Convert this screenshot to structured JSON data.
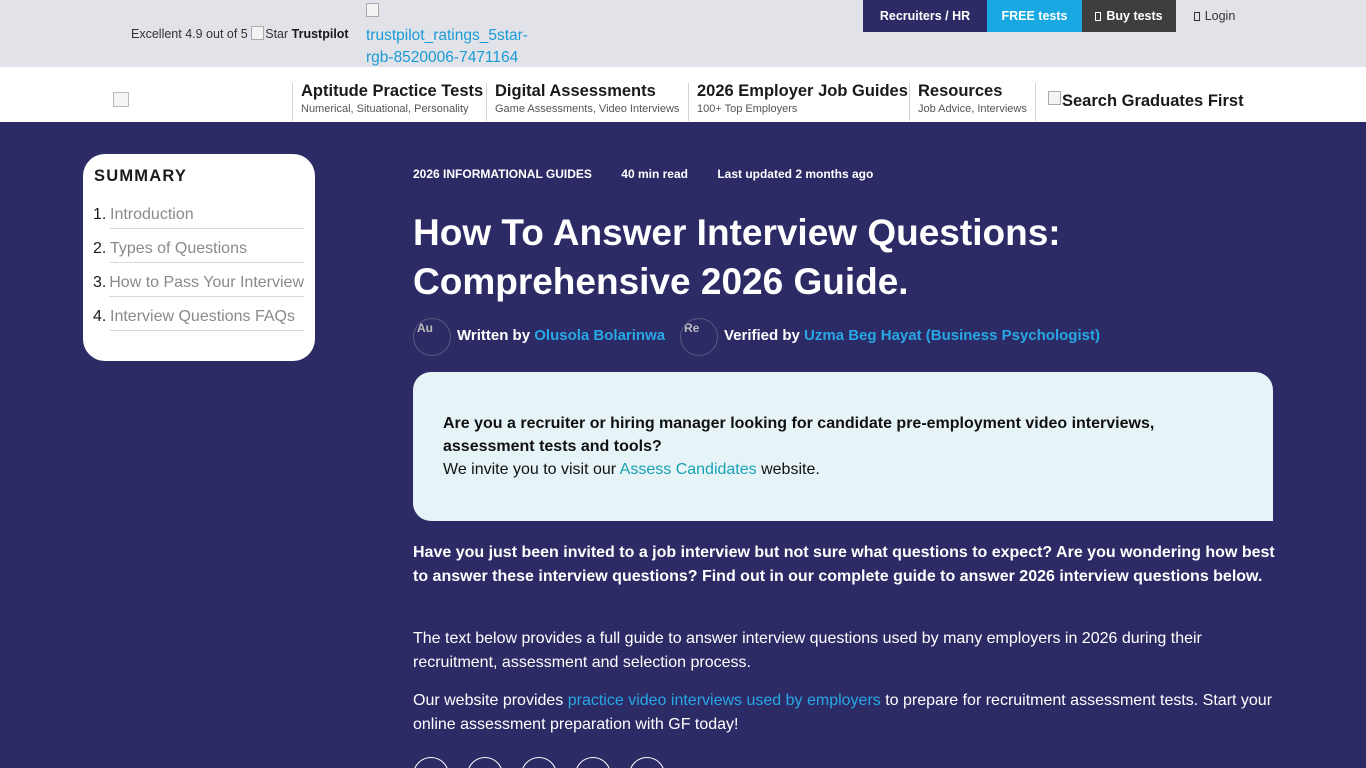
{
  "topbar": {
    "trustpilot_text": "Excellent 4.9 out of 5",
    "star_alt": "Star",
    "trustpilot_brand": "Trustpilot",
    "ratings_alt": "trustpilot_ratings_5star-rgb-8520006-7471164",
    "buttons": {
      "recruiters": "Recruiters / HR",
      "free_tests": "FREE tests",
      "buy_tests": "Buy tests",
      "login": "Login"
    }
  },
  "nav": {
    "items": [
      {
        "title": "Aptitude Practice Tests",
        "subtitle": "Numerical, Situational, Personality"
      },
      {
        "title": "Digital Assessments",
        "subtitle": "Game Assessments, Video Interviews"
      },
      {
        "title": "2026 Employer Job Guides",
        "subtitle": "100+ Top Employers"
      },
      {
        "title": "Resources",
        "subtitle": "Job Advice, Interviews"
      }
    ],
    "search_alt": "Search Graduates First"
  },
  "summary": {
    "title": "SUMMARY",
    "items": [
      {
        "num": "1.",
        "label": "Introduction"
      },
      {
        "num": "2.",
        "label": "Types of Questions"
      },
      {
        "num": "3.",
        "label": "How to Pass Your Interview"
      },
      {
        "num": "4.",
        "label": "Interview Questions FAQs"
      }
    ]
  },
  "article": {
    "category": "2026 INFORMATIONAL GUIDES",
    "read_time": "40 min read",
    "updated": "Last updated 2 months ago",
    "title": "How To Answer Interview Questions: Comprehensive 2026 Guide.",
    "written_by_label": "Written by",
    "author": "Olusola Bolarinwa",
    "author_avatar_alt": "Au",
    "verified_by_label": "Verified by",
    "reviewer": "Uzma Beg Hayat (Business Psychologist)",
    "reviewer_avatar_alt": "Re",
    "callout": {
      "bold": "Are you a recruiter or hiring manager looking for candidate pre-employment video interviews, assessment tests and tools?",
      "pre": "We invite you to visit our ",
      "link": "Assess Candidates",
      "post": " website."
    },
    "intro_bold": "Have you just been invited to a job interview but not sure what questions to expect? Are you wondering how best to answer these interview questions? Find out in our complete guide to answer 2026 interview questions below.",
    "para2": "The text below provides a full guide to answer interview questions used by many employers in 2026 during their recruitment, assessment and selection process.",
    "para3_pre": "Our website provides ",
    "para3_link": "practice video interviews used by employers",
    "para3_post": " to prepare for recruitment assessment tests. Start your online assessment preparation with GF today!"
  },
  "colors": {
    "page_bg": "#2d2b66",
    "topbar_bg": "#e1e3e8",
    "free_tests_bg": "#19a8e2",
    "buy_tests_bg": "#3e3e3e",
    "link": "#27a8e5",
    "callout_bg": "#e6f4f8"
  }
}
